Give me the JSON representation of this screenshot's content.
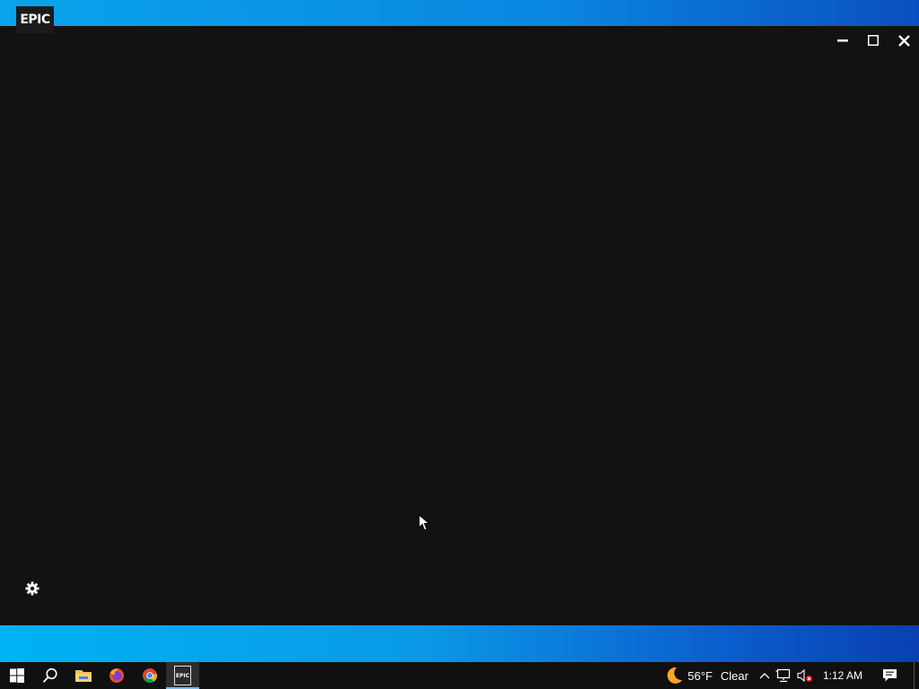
{
  "app": {
    "logo_text": "EPIC",
    "window_controls": {
      "minimize": "minimize-icon",
      "maximize": "maximize-icon",
      "close": "close-icon"
    },
    "settings_icon": "gear-icon"
  },
  "taskbar": {
    "start_icon": "windows-start-icon",
    "search_icon": "search-icon",
    "pinned": [
      {
        "name": "File Explorer",
        "icon": "folder-icon"
      },
      {
        "name": "Firefox",
        "icon": "firefox-icon"
      },
      {
        "name": "Chrome",
        "icon": "chrome-icon"
      },
      {
        "name": "Epic Games Launcher",
        "icon": "epic-games-icon",
        "label": "EPIC",
        "active": true
      }
    ],
    "tray": {
      "weather_icon": "moon-icon",
      "temperature": "56°F",
      "condition": "Clear",
      "time": "1:12 AM"
    }
  },
  "colors": {
    "launcher_background": "#121212",
    "desktop_blue": "#0a86e0",
    "taskbar": "#101010"
  }
}
